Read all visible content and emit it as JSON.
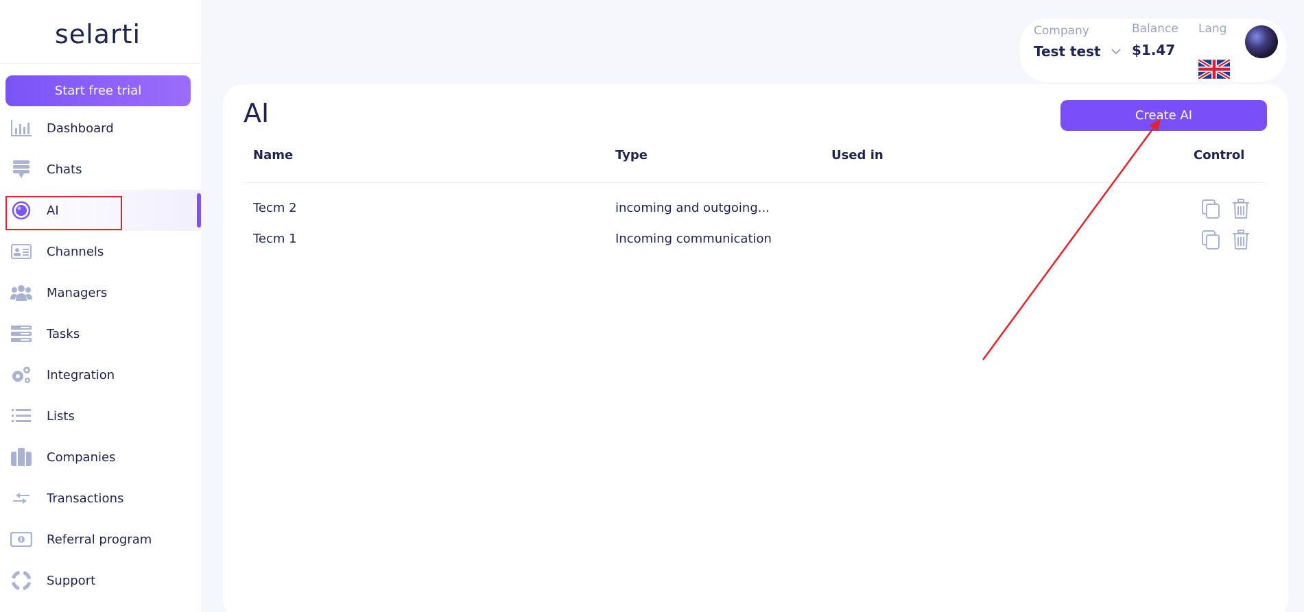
{
  "sidebar": {
    "logo": "selarti",
    "trial_button": "Start free trial",
    "items": [
      {
        "label": "Dashboard",
        "icon": "bar-chart-icon"
      },
      {
        "label": "Chats",
        "icon": "chat-icon"
      },
      {
        "label": "AI",
        "icon": "ai-ring-icon",
        "active": true
      },
      {
        "label": "Channels",
        "icon": "id-card-icon"
      },
      {
        "label": "Managers",
        "icon": "users-icon"
      },
      {
        "label": "Tasks",
        "icon": "tasks-icon"
      },
      {
        "label": "Integration",
        "icon": "gears-icon"
      },
      {
        "label": "Lists",
        "icon": "list-icon"
      },
      {
        "label": "Companies",
        "icon": "briefcase-icon"
      },
      {
        "label": "Transactions",
        "icon": "transfer-arrows-icon"
      },
      {
        "label": "Referral program",
        "icon": "cash-icon"
      },
      {
        "label": "Support",
        "icon": "lifebuoy-icon"
      }
    ]
  },
  "topbar": {
    "company_label": "Company",
    "company_value": "Test test",
    "balance_label": "Balance",
    "balance_value": "$1.47",
    "lang_label": "Lang",
    "lang_icon": "uk-flag-icon"
  },
  "main": {
    "title": "AI",
    "create_button": "Create AI",
    "columns": [
      "Name",
      "Type",
      "Used in",
      "Control"
    ],
    "rows": [
      {
        "name": "Tecm 2",
        "type": "incoming and outgoing...",
        "used_in": ""
      },
      {
        "name": "Tecm 1",
        "type": "Incoming communication",
        "used_in": ""
      }
    ]
  },
  "colors": {
    "accent": "#7a4ef9",
    "icon": "#a9b2d3",
    "text": "#1f2350",
    "annotation": "#e8202a"
  }
}
